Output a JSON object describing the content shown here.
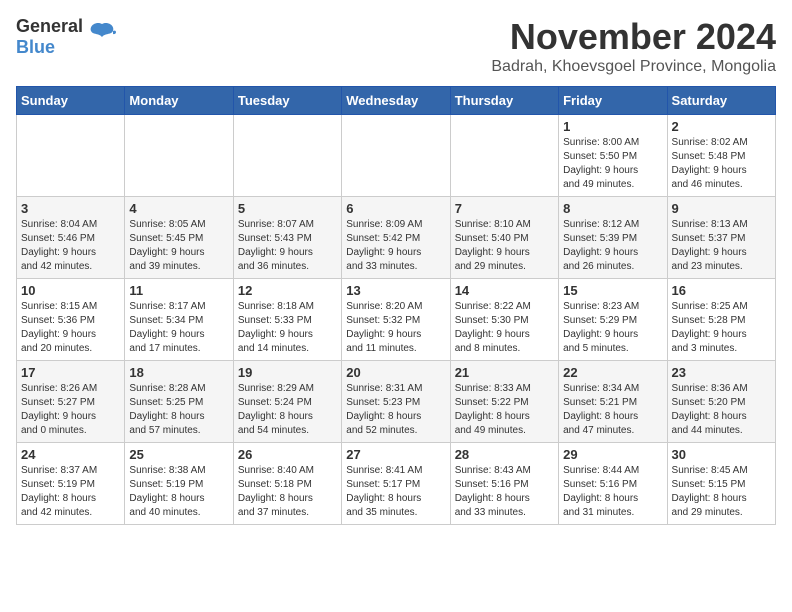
{
  "logo": {
    "general": "General",
    "blue": "Blue"
  },
  "title": "November 2024",
  "subtitle": "Badrah, Khoevsgoel Province, Mongolia",
  "weekdays": [
    "Sunday",
    "Monday",
    "Tuesday",
    "Wednesday",
    "Thursday",
    "Friday",
    "Saturday"
  ],
  "weeks": [
    [
      {
        "day": "",
        "info": ""
      },
      {
        "day": "",
        "info": ""
      },
      {
        "day": "",
        "info": ""
      },
      {
        "day": "",
        "info": ""
      },
      {
        "day": "",
        "info": ""
      },
      {
        "day": "1",
        "info": "Sunrise: 8:00 AM\nSunset: 5:50 PM\nDaylight: 9 hours\nand 49 minutes."
      },
      {
        "day": "2",
        "info": "Sunrise: 8:02 AM\nSunset: 5:48 PM\nDaylight: 9 hours\nand 46 minutes."
      }
    ],
    [
      {
        "day": "3",
        "info": "Sunrise: 8:04 AM\nSunset: 5:46 PM\nDaylight: 9 hours\nand 42 minutes."
      },
      {
        "day": "4",
        "info": "Sunrise: 8:05 AM\nSunset: 5:45 PM\nDaylight: 9 hours\nand 39 minutes."
      },
      {
        "day": "5",
        "info": "Sunrise: 8:07 AM\nSunset: 5:43 PM\nDaylight: 9 hours\nand 36 minutes."
      },
      {
        "day": "6",
        "info": "Sunrise: 8:09 AM\nSunset: 5:42 PM\nDaylight: 9 hours\nand 33 minutes."
      },
      {
        "day": "7",
        "info": "Sunrise: 8:10 AM\nSunset: 5:40 PM\nDaylight: 9 hours\nand 29 minutes."
      },
      {
        "day": "8",
        "info": "Sunrise: 8:12 AM\nSunset: 5:39 PM\nDaylight: 9 hours\nand 26 minutes."
      },
      {
        "day": "9",
        "info": "Sunrise: 8:13 AM\nSunset: 5:37 PM\nDaylight: 9 hours\nand 23 minutes."
      }
    ],
    [
      {
        "day": "10",
        "info": "Sunrise: 8:15 AM\nSunset: 5:36 PM\nDaylight: 9 hours\nand 20 minutes."
      },
      {
        "day": "11",
        "info": "Sunrise: 8:17 AM\nSunset: 5:34 PM\nDaylight: 9 hours\nand 17 minutes."
      },
      {
        "day": "12",
        "info": "Sunrise: 8:18 AM\nSunset: 5:33 PM\nDaylight: 9 hours\nand 14 minutes."
      },
      {
        "day": "13",
        "info": "Sunrise: 8:20 AM\nSunset: 5:32 PM\nDaylight: 9 hours\nand 11 minutes."
      },
      {
        "day": "14",
        "info": "Sunrise: 8:22 AM\nSunset: 5:30 PM\nDaylight: 9 hours\nand 8 minutes."
      },
      {
        "day": "15",
        "info": "Sunrise: 8:23 AM\nSunset: 5:29 PM\nDaylight: 9 hours\nand 5 minutes."
      },
      {
        "day": "16",
        "info": "Sunrise: 8:25 AM\nSunset: 5:28 PM\nDaylight: 9 hours\nand 3 minutes."
      }
    ],
    [
      {
        "day": "17",
        "info": "Sunrise: 8:26 AM\nSunset: 5:27 PM\nDaylight: 9 hours\nand 0 minutes."
      },
      {
        "day": "18",
        "info": "Sunrise: 8:28 AM\nSunset: 5:25 PM\nDaylight: 8 hours\nand 57 minutes."
      },
      {
        "day": "19",
        "info": "Sunrise: 8:29 AM\nSunset: 5:24 PM\nDaylight: 8 hours\nand 54 minutes."
      },
      {
        "day": "20",
        "info": "Sunrise: 8:31 AM\nSunset: 5:23 PM\nDaylight: 8 hours\nand 52 minutes."
      },
      {
        "day": "21",
        "info": "Sunrise: 8:33 AM\nSunset: 5:22 PM\nDaylight: 8 hours\nand 49 minutes."
      },
      {
        "day": "22",
        "info": "Sunrise: 8:34 AM\nSunset: 5:21 PM\nDaylight: 8 hours\nand 47 minutes."
      },
      {
        "day": "23",
        "info": "Sunrise: 8:36 AM\nSunset: 5:20 PM\nDaylight: 8 hours\nand 44 minutes."
      }
    ],
    [
      {
        "day": "24",
        "info": "Sunrise: 8:37 AM\nSunset: 5:19 PM\nDaylight: 8 hours\nand 42 minutes."
      },
      {
        "day": "25",
        "info": "Sunrise: 8:38 AM\nSunset: 5:19 PM\nDaylight: 8 hours\nand 40 minutes."
      },
      {
        "day": "26",
        "info": "Sunrise: 8:40 AM\nSunset: 5:18 PM\nDaylight: 8 hours\nand 37 minutes."
      },
      {
        "day": "27",
        "info": "Sunrise: 8:41 AM\nSunset: 5:17 PM\nDaylight: 8 hours\nand 35 minutes."
      },
      {
        "day": "28",
        "info": "Sunrise: 8:43 AM\nSunset: 5:16 PM\nDaylight: 8 hours\nand 33 minutes."
      },
      {
        "day": "29",
        "info": "Sunrise: 8:44 AM\nSunset: 5:16 PM\nDaylight: 8 hours\nand 31 minutes."
      },
      {
        "day": "30",
        "info": "Sunrise: 8:45 AM\nSunset: 5:15 PM\nDaylight: 8 hours\nand 29 minutes."
      }
    ]
  ]
}
